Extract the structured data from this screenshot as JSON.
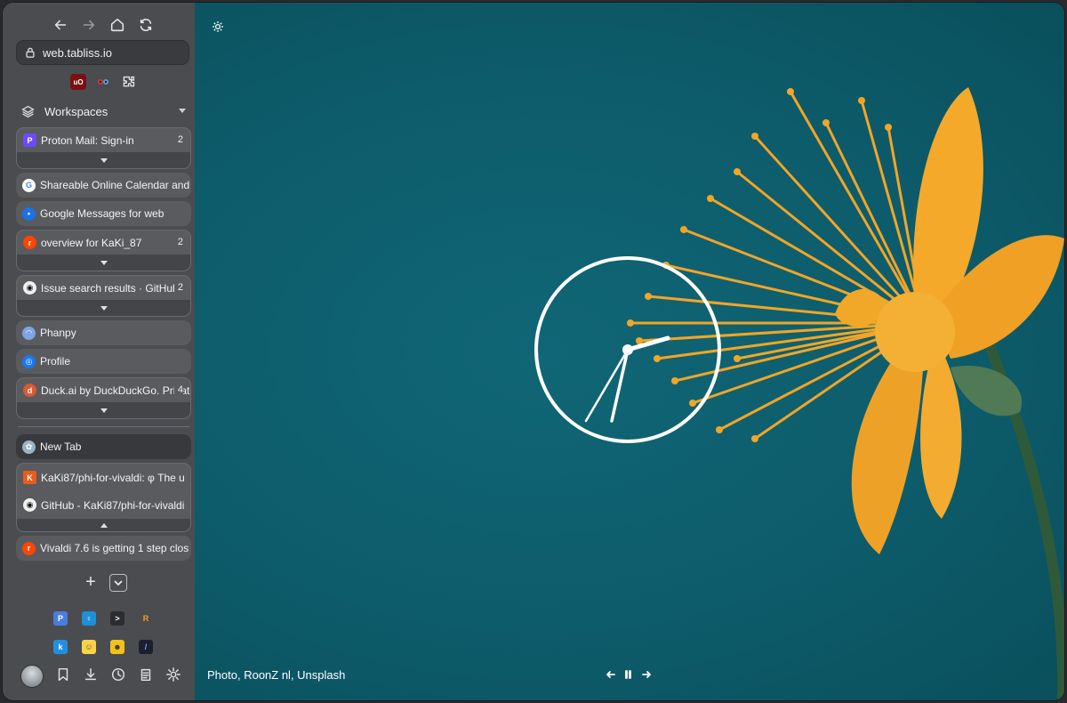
{
  "sidebar": {
    "url": "web.tabliss.io",
    "workspaces_label": "Workspaces",
    "tabs": [
      {
        "title": "Proton Mail: Sign-in",
        "count": "2",
        "stacked": true
      },
      {
        "title": "Shareable Online Calendar and"
      },
      {
        "title": "Google Messages for web"
      },
      {
        "title": "overview for KaKi_87",
        "count": "2",
        "stacked": true
      },
      {
        "title": "Issue search results · GitHub",
        "count": "2",
        "stacked": true
      },
      {
        "title": "Phanpy"
      },
      {
        "title": "Profile"
      },
      {
        "title": "Duck.ai by DuckDuckGo. Private",
        "count": "4",
        "stacked": true
      }
    ],
    "pinned_section": {
      "active_tab": "New Tab",
      "stack_tabs": [
        "KaKi87/phi-for-vivaldi: φ The u",
        "GitHub - KaKi87/phi-for-vivaldi"
      ],
      "last_tab": "Vivaldi 7.6 is getting 1 step clos"
    },
    "extension_icons": [
      "ublock-origin-icon",
      "extension-puppy-icon",
      "extensions-puzzle-icon"
    ],
    "web_panels": [
      "proton-pass-icon",
      "keyhole-icon",
      "terminal-app-icon",
      "r-app-icon",
      "k-app-icon",
      "emoji-app-icon",
      "cool-face-app-icon",
      "dark-app-icon"
    ],
    "bottom_icons": [
      "avatar",
      "bookmark-icon",
      "download-icon",
      "history-icon",
      "notes-icon",
      "settings-icon"
    ]
  },
  "content": {
    "photo_credit": "Photo, RoonZ nl, Unsplash",
    "background_color": "#0d5d6d",
    "accent_flower": "#f2a526"
  }
}
